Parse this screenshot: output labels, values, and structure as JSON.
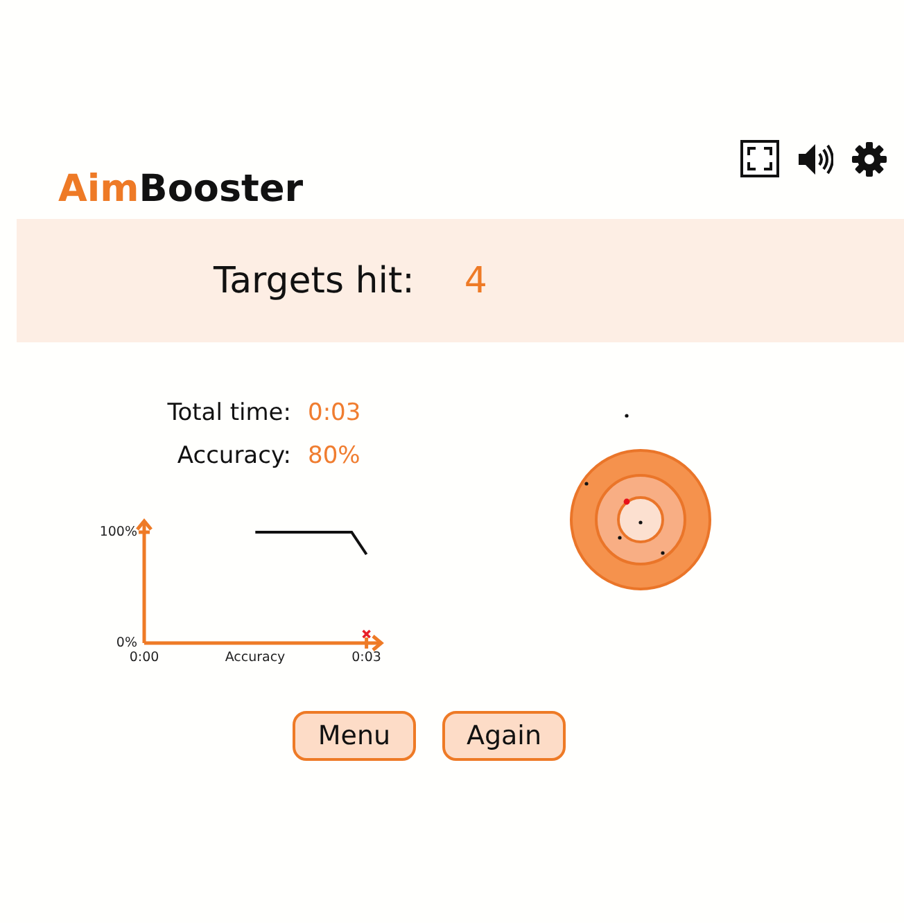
{
  "header": {
    "logo": {
      "accent": "Aim",
      "rest": "Booster"
    }
  },
  "result": {
    "label": "Targets hit:",
    "value": "4"
  },
  "stats": [
    {
      "label": "Total time:",
      "value": "0:03"
    },
    {
      "label": "Accuracy:",
      "value": "80%"
    }
  ],
  "chart": {
    "chart_data": {
      "type": "line",
      "xlabel": "Accuracy",
      "xlim": [
        0,
        3.2
      ],
      "ylim": [
        0,
        110
      ],
      "xticks": [
        {
          "value": 0,
          "label": "0:00"
        },
        {
          "value": 3,
          "label": "0:03"
        }
      ],
      "yticks": [
        {
          "value": 0,
          "label": "0%"
        },
        {
          "value": 100,
          "label": "100%"
        }
      ],
      "x": [
        1.5,
        2.8,
        3
      ],
      "series": [
        {
          "color": "#111111",
          "values": [
            100,
            100,
            80
          ]
        }
      ]
    },
    "last_shot_missed": true
  },
  "buttons": [
    "Menu",
    "Again"
  ]
}
